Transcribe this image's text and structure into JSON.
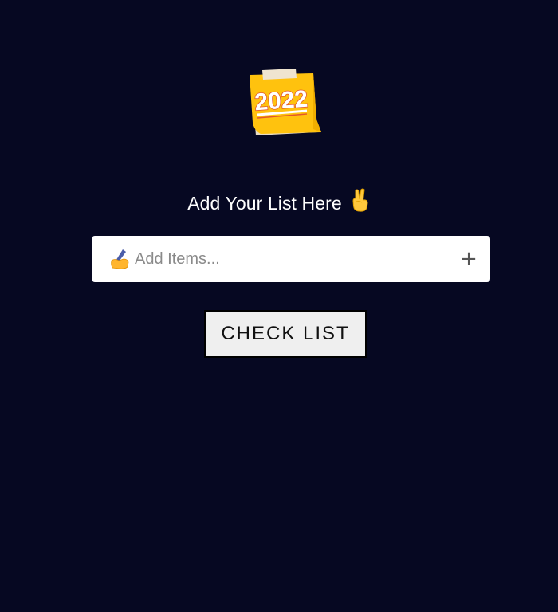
{
  "logo": {
    "year": "2022",
    "icon": "sticky-note-icon",
    "colors": {
      "note": "#FFC20E",
      "note_shadow": "#E8DCC4",
      "tape": "#EFE4CF",
      "year_text": "#FFFFFF",
      "year_outline": "#E3572B"
    }
  },
  "heading": {
    "text": "Add Your List Here",
    "emoji": "✌️"
  },
  "input": {
    "placeholder": "Add Items...",
    "value": "",
    "icon": "writing-hand-icon",
    "add_label": "+"
  },
  "check_button": {
    "label": "CHECK LIST"
  },
  "colors": {
    "background": "#060822",
    "input_bg": "#FFFFFF",
    "button_bg": "#EFEFEF",
    "button_border": "#000000"
  }
}
